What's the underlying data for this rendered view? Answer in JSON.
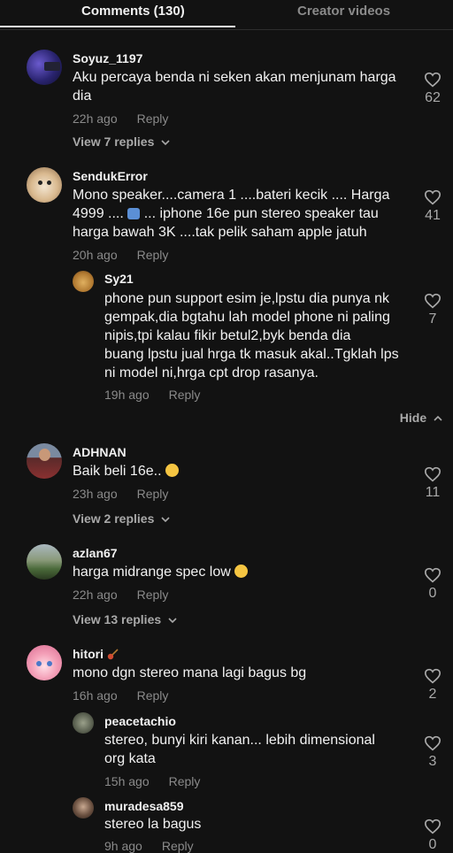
{
  "tabs": {
    "comments": "Comments (130)",
    "creator": "Creator videos"
  },
  "comments": [
    {
      "username": "Soyuz_1197",
      "text_l1": "Aku percaya benda ni seken akan menjunam harga",
      "text_l2": "dia",
      "time": "22h ago",
      "reply": "Reply",
      "likes": "62",
      "view_replies": "View 7 replies"
    },
    {
      "username": "SendukError",
      "text_l1": "Mono speaker....camera 1 ....bateri kecik .... Harga",
      "text_l2a": "4999 ....",
      "text_l2b": "... iphone 16e pun stereo speaker tau",
      "text_l3": "harga bawah 3K ....tak pelik saham apple jatuh",
      "time": "20h ago",
      "reply": "Reply",
      "likes": "41"
    },
    {
      "username": "Sy21",
      "text_l1": "phone pun support esim je,lpstu dia punya nk",
      "text_l2": "gempak,dia bgtahu lah model phone ni paling",
      "text_l3": "nipis,tpi kalau fikir betul2,byk benda dia",
      "text_l4": "buang lpstu jual hrga tk masuk akal..Tgklah lps",
      "text_l5": "ni model ni,hrga cpt drop rasanya.",
      "time": "19h ago",
      "reply": "Reply",
      "likes": "7",
      "hide": "Hide"
    },
    {
      "username": "ADHNAN",
      "text_l1": "Baik beli 16e..",
      "time": "23h ago",
      "reply": "Reply",
      "likes": "11",
      "view_replies": "View 2 replies"
    },
    {
      "username": "azlan67",
      "text_l1": "harga midrange spec low",
      "time": "22h ago",
      "reply": "Reply",
      "likes": "0",
      "view_replies": "View 13 replies"
    },
    {
      "username": "hitori",
      "text_l1": "mono dgn stereo mana lagi bagus bg",
      "time": "16h ago",
      "reply": "Reply",
      "likes": "2"
    },
    {
      "username": "peacetachio",
      "text_l1": "stereo, bunyi kiri kanan... lebih dimensional",
      "text_l2": "org kata",
      "time": "15h ago",
      "reply": "Reply",
      "likes": "3"
    },
    {
      "username": "muradesa859",
      "text_l1": "stereo la bagus",
      "time": "9h ago",
      "reply": "Reply",
      "likes": "0"
    }
  ],
  "icons": {
    "like": "heart-outline-icon",
    "expand": "chevron-down-icon",
    "collapse": "chevron-up-icon"
  },
  "colors": {
    "background": "#121212",
    "text": "#f1f1f1",
    "muted": "#8a8a8a"
  }
}
